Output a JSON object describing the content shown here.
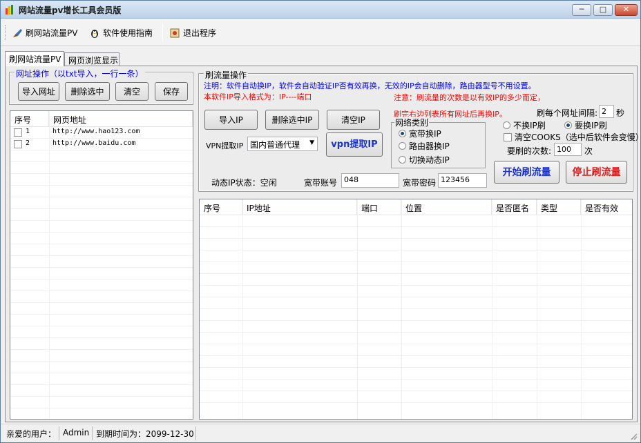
{
  "window": {
    "title": "网站流量pv增长工具会员版"
  },
  "toolbar": {
    "items": [
      "刷网站流量PV",
      "软件使用指南",
      "退出程序"
    ]
  },
  "tabs": [
    "刷网站流量PV",
    "网页浏览显示"
  ],
  "url_group": {
    "legend": "网址操作（以txt导入，一行一条）",
    "import": "导入网址",
    "delete": "删除选中",
    "clear": "清空",
    "save": "保存"
  },
  "url_table": {
    "columns": [
      "序号",
      "网页地址"
    ],
    "rows": [
      {
        "no": "1",
        "url": "http://www.hao123.com"
      },
      {
        "no": "2",
        "url": "http://www.baidu.com"
      }
    ]
  },
  "traffic": {
    "legend": "刷流量操作",
    "note1": "注明：软件自动换IP，软件会自动验证IP否有效再换，无效的IP会自动删除，路由器型号不用设置。",
    "note2": "本软件IP导入格式为：IP----端口",
    "note3": "注意：刷流量的次数是以有效IP的多少而定，",
    "note4": "刷完右边列表所有网址后再换IP。",
    "import_ip": "导入IP",
    "delete_ip": "删除选中IP",
    "clear_ip": "清空IP",
    "interval_label": "刷每个网址间隔:",
    "interval_value": "2",
    "interval_unit": "秒",
    "network_legend": "网络类别",
    "net_options": [
      "宽带换IP",
      "路由器换IP",
      "切换动态IP"
    ],
    "vpn_label": "VPN提取IP",
    "vpn_select": "国内普通代理",
    "vpn_button": "vpn提取IP",
    "no_change_ip": "不换IP刷",
    "change_ip": "要换IP刷",
    "clear_cookies": "清空COOKS（选中后软件会变慢）",
    "times_label": "要刷的次数:",
    "times_value": "100",
    "times_unit": "次",
    "start": "开始刷流量",
    "stop": "停止刷流量",
    "dyn_status": "动态IP状态：空闲",
    "account_label": "宽带账号",
    "account_value": "048",
    "password_label": "宽带密码",
    "password_value": "123456"
  },
  "ip_table": {
    "columns": [
      "序号",
      "IP地址",
      "端口",
      "位置",
      "是否匿名",
      "类型",
      "是否有效"
    ]
  },
  "status": {
    "user_label": "亲爱的用户：",
    "user": "Admin",
    "expiry": "到期时间为：2099-12-30"
  },
  "colors": {
    "blue_text": "#0000ff",
    "red_text": "#ff0000",
    "start_color": "#1c33c8",
    "stop_color": "#e21b1b"
  }
}
